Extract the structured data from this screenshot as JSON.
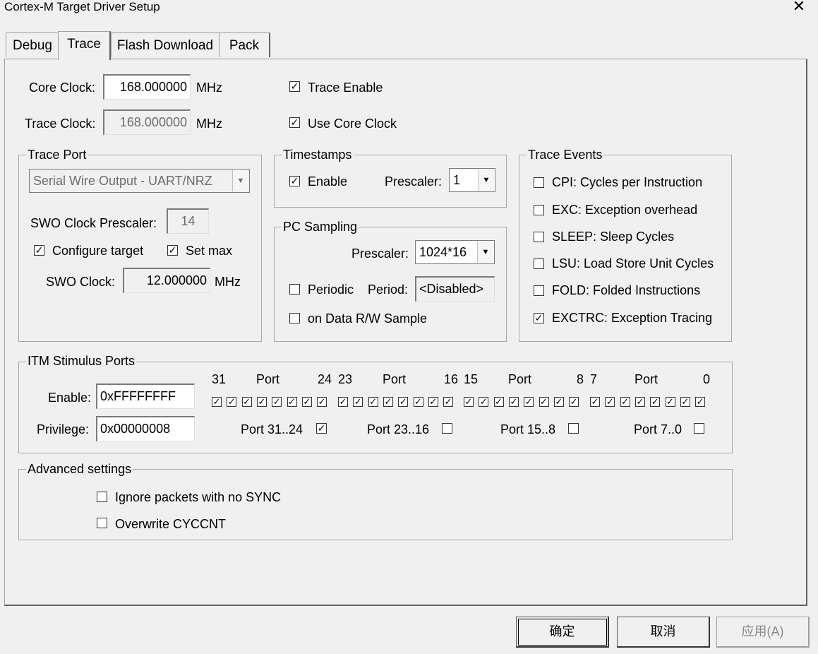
{
  "window": {
    "title": "Cortex-M Target Driver Setup"
  },
  "tabs": [
    {
      "label": "Debug"
    },
    {
      "label": "Trace"
    },
    {
      "label": "Flash Download"
    },
    {
      "label": "Pack"
    }
  ],
  "clock": {
    "core_label": "Core Clock:",
    "core_value": "168.000000",
    "core_unit": "MHz",
    "trace_label": "Trace Clock:",
    "trace_value": "168.000000",
    "trace_unit": "MHz",
    "trace_enable": "Trace Enable",
    "trace_enable_checked": true,
    "use_core": "Use Core Clock",
    "use_core_checked": true
  },
  "trace_port": {
    "title": "Trace Port",
    "mode": "Serial Wire Output - UART/NRZ",
    "swo_prescaler_label": "SWO Clock Prescaler:",
    "swo_prescaler_value": "14",
    "configure_target": "Configure target",
    "configure_target_checked": true,
    "set_max": "Set max",
    "set_max_checked": true,
    "swo_clock_label": "SWO Clock:",
    "swo_clock_value": "12.000000",
    "swo_clock_unit": "MHz"
  },
  "timestamps": {
    "title": "Timestamps",
    "enable": "Enable",
    "enable_checked": true,
    "prescaler_label": "Prescaler:",
    "prescaler_value": "1"
  },
  "pc_sampling": {
    "title": "PC Sampling",
    "prescaler_label": "Prescaler:",
    "prescaler_value": "1024*16",
    "periodic": "Periodic",
    "periodic_checked": false,
    "period_label": "Period:",
    "period_value": "<Disabled>",
    "data_rw": "on Data R/W Sample",
    "data_rw_checked": false
  },
  "trace_events": {
    "title": "Trace Events",
    "items": [
      {
        "label": "CPI: Cycles per Instruction",
        "checked": false
      },
      {
        "label": "EXC: Exception overhead",
        "checked": false
      },
      {
        "label": "SLEEP: Sleep Cycles",
        "checked": false
      },
      {
        "label": "LSU: Load Store Unit Cycles",
        "checked": false
      },
      {
        "label": "FOLD: Folded Instructions",
        "checked": false
      },
      {
        "label": "EXCTRC: Exception Tracing",
        "checked": true
      }
    ]
  },
  "itm": {
    "title": "ITM Stimulus Ports",
    "enable_label": "Enable:",
    "enable_value": "0xFFFFFFFF",
    "privilege_label": "Privilege:",
    "privilege_value": "0x00000008",
    "port_word": "Port",
    "groups": [
      {
        "hi": "31",
        "lo": "24",
        "privilege_label": "Port 31..24",
        "privilege_checked": true
      },
      {
        "hi": "23",
        "lo": "16",
        "privilege_label": "Port 23..16",
        "privilege_checked": false
      },
      {
        "hi": "15",
        "lo": "8",
        "privilege_label": "Port 15..8",
        "privilege_checked": false
      },
      {
        "hi": "7",
        "lo": "0",
        "privilege_label": "Port 7..0",
        "privilege_checked": false
      }
    ]
  },
  "advanced": {
    "title": "Advanced settings",
    "ignore_sync": "Ignore packets with no SYNC",
    "ignore_sync_checked": false,
    "overwrite_cyccnt": "Overwrite CYCCNT",
    "overwrite_cyccnt_checked": false
  },
  "buttons": {
    "ok": "确定",
    "cancel": "取消",
    "apply": "应用(A)"
  }
}
